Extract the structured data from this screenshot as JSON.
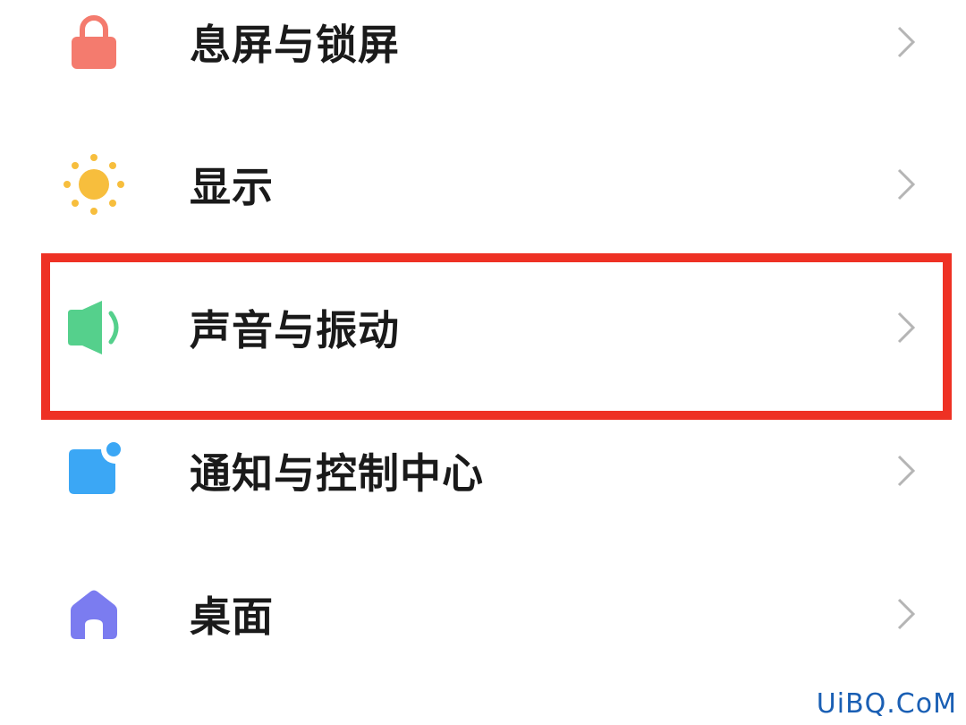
{
  "settings_list": {
    "items": [
      {
        "label": "息屏与锁屏",
        "icon": "lock-icon",
        "color": "#f47b6e"
      },
      {
        "label": "显示",
        "icon": "sun-icon",
        "color": "#f7be3d"
      },
      {
        "label": "声音与振动",
        "icon": "speaker-icon",
        "color": "#55d08c",
        "highlighted": true
      },
      {
        "label": "通知与控制中心",
        "icon": "notification-icon",
        "color": "#3ba7f5"
      },
      {
        "label": "桌面",
        "icon": "home-icon",
        "color": "#7b7cf0"
      }
    ]
  },
  "highlight": {
    "color": "#ee3124"
  },
  "watermark": {
    "text": "UiBQ.CoM"
  }
}
